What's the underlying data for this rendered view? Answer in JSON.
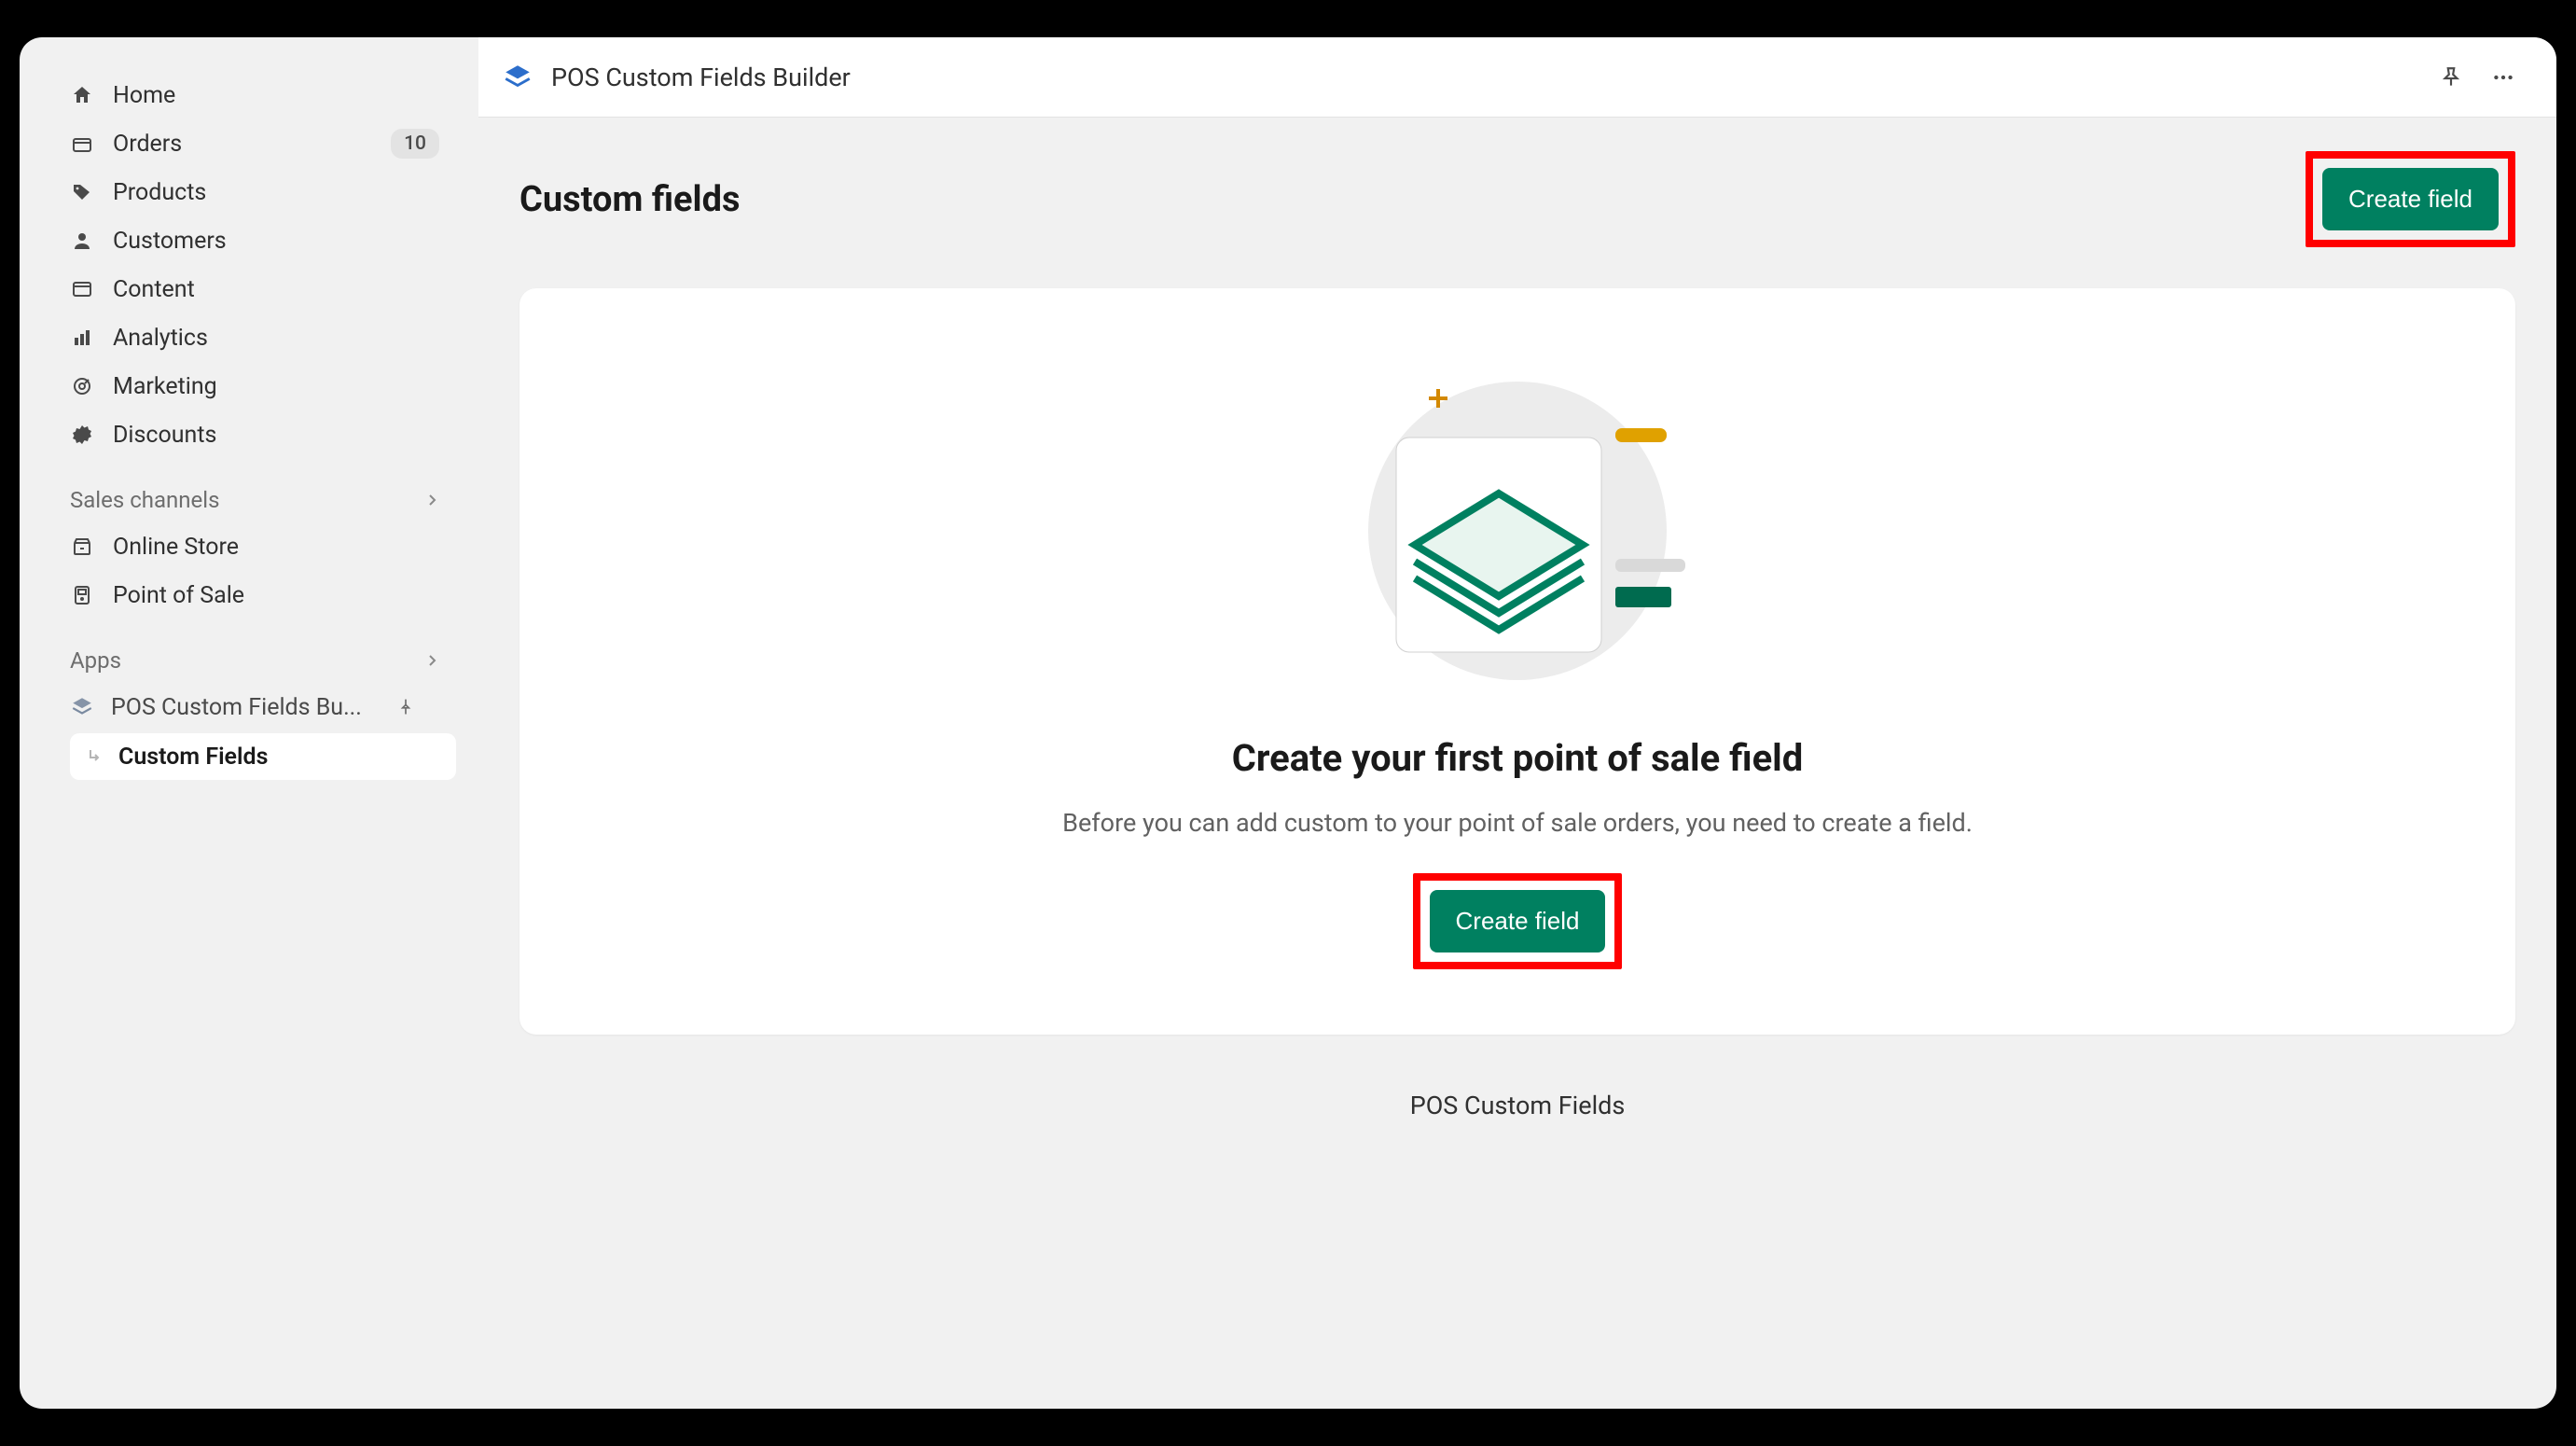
{
  "sidebar": {
    "nav": [
      {
        "label": "Home"
      },
      {
        "label": "Orders",
        "badge": "10"
      },
      {
        "label": "Products"
      },
      {
        "label": "Customers"
      },
      {
        "label": "Content"
      },
      {
        "label": "Analytics"
      },
      {
        "label": "Marketing"
      },
      {
        "label": "Discounts"
      }
    ],
    "sales_channels_header": "Sales channels",
    "sales_channels": [
      {
        "label": "Online Store"
      },
      {
        "label": "Point of Sale"
      }
    ],
    "apps_header": "Apps",
    "app_item_label": "POS Custom Fields Bu...",
    "app_sub_label": "Custom Fields"
  },
  "topbar": {
    "title": "POS Custom Fields Builder"
  },
  "page": {
    "title": "Custom fields",
    "create_button": "Create field"
  },
  "empty_state": {
    "heading": "Create your first point of sale field",
    "subheading": "Before you can add custom to your point of sale orders, you need to create a field.",
    "button": "Create field"
  },
  "footer": "POS Custom Fields",
  "colors": {
    "primary_button": "#008060",
    "highlight_border": "#ff0000"
  }
}
